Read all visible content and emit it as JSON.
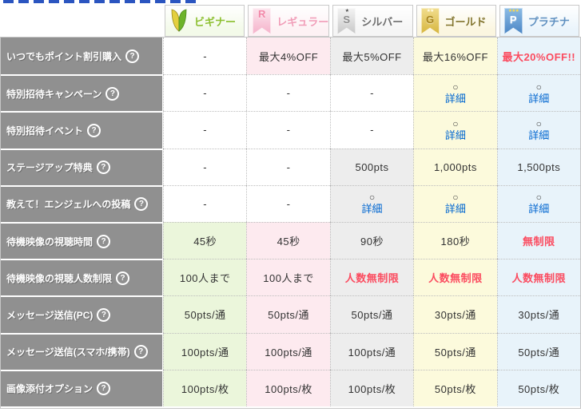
{
  "help_icon_glyph": "?",
  "detail_cell": {
    "circle_glyph": "○",
    "link_label": "詳細"
  },
  "colors": {
    "accent_red": "#fb4b5f",
    "link_blue": "#0066d0",
    "row_label_bg": "#909090",
    "dotted_border": "#bdbdbd",
    "clipped_title_blue": "#2b55c0"
  },
  "tiers": [
    {
      "key": "beginner",
      "label": "ビギナー",
      "label_color": "#8cbf2f",
      "header_bg": "#f3fae9",
      "cell_bg": "#ebf6db",
      "badge": "wakaba-leaf-icon",
      "stars": 0,
      "leaf_left": "#e3cf3e",
      "leaf_right": "#6db32a"
    },
    {
      "key": "regular",
      "label": "レギュラー",
      "label_color": "#f19db8",
      "header_bg": "#fdf1f4",
      "cell_bg": "#fdeaef",
      "badge": "ribbon-R-icon",
      "letter": "R",
      "stars": 0,
      "star_color": "#ffffff",
      "ribbon_from": "#fce6ee",
      "ribbon_to": "#f5b2ca",
      "letter_color": "#f287a8"
    },
    {
      "key": "silver",
      "label": "シルバー",
      "label_color": "#6e6e6e",
      "header_bg": "#f5f5f5",
      "cell_bg": "#ededed",
      "badge": "ribbon-S-icon",
      "letter": "S",
      "stars": 1,
      "star_color": "#4a4a4a",
      "ribbon_from": "#f4f4f4",
      "ribbon_to": "#c7c7c7",
      "letter_color": "#8d8d8d"
    },
    {
      "key": "gold",
      "label": "ゴールド",
      "label_color": "#83752f",
      "header_bg": "#fbf6e0",
      "cell_bg": "#fcfadc",
      "badge": "ribbon-G-icon",
      "letter": "G",
      "stars": 2,
      "star_color": "#fffbe6",
      "ribbon_from": "#f1dd8d",
      "ribbon_to": "#d6b53e",
      "letter_color": "#a5831c"
    },
    {
      "key": "platinum",
      "label": "プラチナ",
      "label_color": "#5e8fc0",
      "header_bg": "#eaf4fb",
      "cell_bg": "#e8f3fa",
      "badge": "ribbon-P-icon",
      "letter": "P",
      "stars": 3,
      "star_color": "#ffd94a",
      "ribbon_from": "#8cbce6",
      "ribbon_to": "#4a85c4",
      "letter_color": "#ffffff"
    }
  ],
  "rows": [
    {
      "label": "いつでもポイント割引購入",
      "cells": [
        {
          "type": "dash",
          "text": "-"
        },
        {
          "type": "text",
          "text": "最大4%OFF"
        },
        {
          "type": "text",
          "text": "最大5%OFF"
        },
        {
          "type": "text",
          "text": "最大16%OFF"
        },
        {
          "type": "text",
          "text": "最大20%OFF!!",
          "emphasis": true
        }
      ]
    },
    {
      "label": "特別招待キャンペーン",
      "cells": [
        {
          "type": "dash",
          "text": "-"
        },
        {
          "type": "dash",
          "text": "-"
        },
        {
          "type": "dash",
          "text": "-"
        },
        {
          "type": "detail"
        },
        {
          "type": "detail"
        }
      ]
    },
    {
      "label": "特別招待イベント",
      "cells": [
        {
          "type": "dash",
          "text": "-"
        },
        {
          "type": "dash",
          "text": "-"
        },
        {
          "type": "dash",
          "text": "-"
        },
        {
          "type": "detail"
        },
        {
          "type": "detail"
        }
      ]
    },
    {
      "label": "ステージアップ特典",
      "cells": [
        {
          "type": "dash",
          "text": "-"
        },
        {
          "type": "dash",
          "text": "-"
        },
        {
          "type": "text",
          "text": "500pts"
        },
        {
          "type": "text",
          "text": "1,000pts"
        },
        {
          "type": "text",
          "text": "1,500pts"
        }
      ]
    },
    {
      "label": "教えて！エンジェルへの投稿",
      "cells": [
        {
          "type": "dash",
          "text": "-"
        },
        {
          "type": "dash",
          "text": "-"
        },
        {
          "type": "detail"
        },
        {
          "type": "detail"
        },
        {
          "type": "detail"
        }
      ]
    },
    {
      "label": "待機映像の視聴時間",
      "cells": [
        {
          "type": "text",
          "text": "45秒"
        },
        {
          "type": "text",
          "text": "45秒"
        },
        {
          "type": "text",
          "text": "90秒"
        },
        {
          "type": "text",
          "text": "180秒"
        },
        {
          "type": "text",
          "text": "無制限",
          "emphasis": true
        }
      ]
    },
    {
      "label": "待機映像の視聴人数制限",
      "cells": [
        {
          "type": "text",
          "text": "100人まで"
        },
        {
          "type": "text",
          "text": "100人まで"
        },
        {
          "type": "text",
          "text": "人数無制限",
          "emphasis": true
        },
        {
          "type": "text",
          "text": "人数無制限",
          "emphasis": true
        },
        {
          "type": "text",
          "text": "人数無制限",
          "emphasis": true
        }
      ]
    },
    {
      "label": "メッセージ送信(PC)",
      "cells": [
        {
          "type": "text",
          "text": "50pts/通"
        },
        {
          "type": "text",
          "text": "50pts/通"
        },
        {
          "type": "text",
          "text": "50pts/通"
        },
        {
          "type": "text",
          "text": "30pts/通"
        },
        {
          "type": "text",
          "text": "30pts/通"
        }
      ]
    },
    {
      "label": "メッセージ送信(スマホ/携帯)",
      "cells": [
        {
          "type": "text",
          "text": "100pts/通"
        },
        {
          "type": "text",
          "text": "100pts/通"
        },
        {
          "type": "text",
          "text": "100pts/通"
        },
        {
          "type": "text",
          "text": "50pts/通"
        },
        {
          "type": "text",
          "text": "50pts/通"
        }
      ]
    },
    {
      "label": "画像添付オプション",
      "cells": [
        {
          "type": "text",
          "text": "100pts/枚"
        },
        {
          "type": "text",
          "text": "100pts/枚"
        },
        {
          "type": "text",
          "text": "100pts/枚"
        },
        {
          "type": "text",
          "text": "50pts/枚"
        },
        {
          "type": "text",
          "text": "50pts/枚"
        }
      ]
    }
  ]
}
